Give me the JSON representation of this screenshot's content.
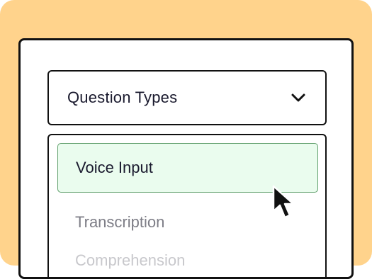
{
  "dropdown": {
    "label": "Question Types",
    "options": [
      {
        "label": "Voice Input",
        "state": "highlighted"
      },
      {
        "label": "Transcription",
        "state": "normal"
      },
      {
        "label": "Comprehension",
        "state": "faded"
      }
    ]
  },
  "icons": {
    "toggle": "chevron-down-icon",
    "pointer": "mouse-cursor-icon"
  },
  "colors": {
    "background": "#ffd38c",
    "highlight_fill": "#eafcee",
    "highlight_border": "#5e9e6a",
    "text": "#1a1a2e"
  }
}
